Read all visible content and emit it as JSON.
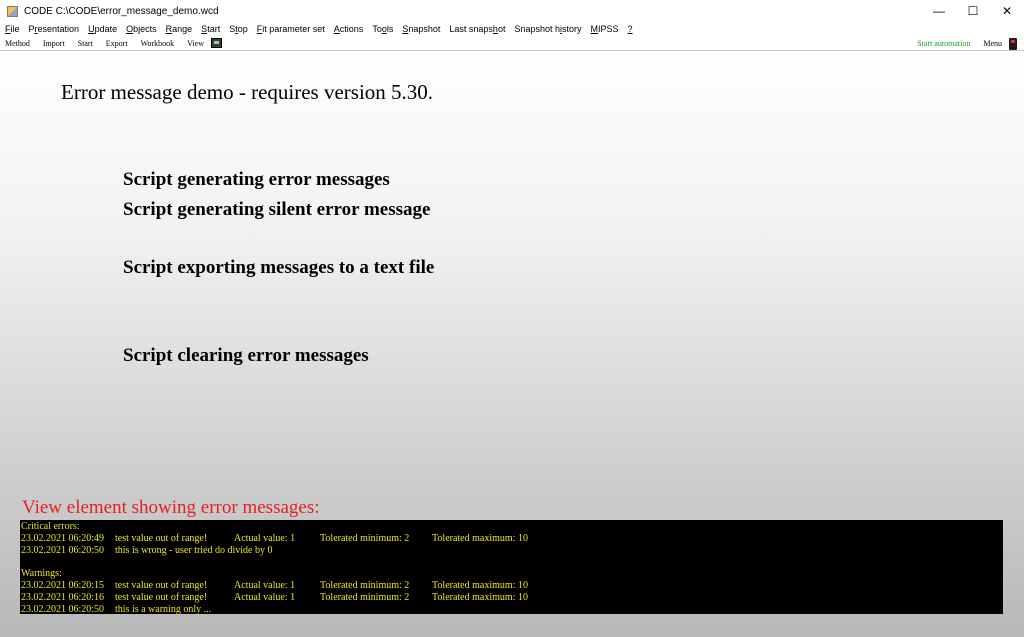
{
  "window": {
    "title": "CODE C:\\CODE\\error_message_demo.wcd",
    "controls": {
      "minimize": "—",
      "maximize": "☐",
      "close": "✕"
    }
  },
  "menu": [
    {
      "pre": "",
      "u": "F",
      "post": "ile",
      "name": "file"
    },
    {
      "pre": "P",
      "u": "r",
      "post": "esentation",
      "name": "presentation"
    },
    {
      "pre": "",
      "u": "U",
      "post": "pdate",
      "name": "update"
    },
    {
      "pre": "",
      "u": "O",
      "post": "bjects",
      "name": "objects"
    },
    {
      "pre": "",
      "u": "R",
      "post": "ange",
      "name": "range"
    },
    {
      "pre": "",
      "u": "S",
      "post": "tart",
      "name": "start"
    },
    {
      "pre": "S",
      "u": "t",
      "post": "op",
      "name": "stop"
    },
    {
      "pre": "",
      "u": "F",
      "post": "it parameter set",
      "name": "fit-parameter-set"
    },
    {
      "pre": "",
      "u": "A",
      "post": "ctions",
      "name": "actions"
    },
    {
      "pre": "To",
      "u": "o",
      "post": "ls",
      "name": "tools"
    },
    {
      "pre": "",
      "u": "S",
      "post": "napshot",
      "name": "snapshot"
    },
    {
      "pre": "Last snaps",
      "u": "h",
      "post": "ot",
      "name": "last-snapshot"
    },
    {
      "pre": "Snapshot h",
      "u": "i",
      "post": "story",
      "name": "snapshot-history"
    },
    {
      "pre": "",
      "u": "M",
      "post": "IPSS",
      "name": "mipss"
    },
    {
      "pre": "",
      "u": "?",
      "post": "",
      "name": "help"
    }
  ],
  "toolbar": {
    "items": [
      "Method",
      "Import",
      "Start",
      "Export",
      "Workbook",
      "View"
    ],
    "start_automation": "Start automation",
    "menu": "Menu"
  },
  "main": {
    "title": "Error message demo - requires version 5.30.",
    "scripts": [
      "Script generating error messages",
      "Script generating silent error message",
      "Script exporting messages to a text file",
      "Script clearing error messages"
    ],
    "view_label": "View element showing error messages:"
  },
  "errors": {
    "critical_heading": "Critical errors:",
    "critical": [
      {
        "time": "23.02.2021 06:20:49",
        "msg": "test value out of range!",
        "actual": "Actual value: 1",
        "min": "Tolerated minimum: 2",
        "max": "Tolerated maximum: 10"
      },
      {
        "time": "23.02.2021 06:20:50",
        "msg": "this is wrong - user tried do divide by 0",
        "actual": "",
        "min": "",
        "max": ""
      }
    ],
    "warnings_heading": "Warnings:",
    "warnings": [
      {
        "time": "23.02.2021 06:20:15",
        "msg": "test value out of range!",
        "actual": "Actual value: 1",
        "min": "Tolerated minimum: 2",
        "max": "Tolerated maximum: 10"
      },
      {
        "time": "23.02.2021 06:20:16",
        "msg": "test value out of range!",
        "actual": "Actual value: 1",
        "min": "Tolerated minimum: 2",
        "max": "Tolerated maximum: 10"
      },
      {
        "time": "23.02.2021 06:20:50",
        "msg": "this is a warning only ...",
        "actual": "",
        "min": "",
        "max": ""
      }
    ]
  },
  "colors": {
    "panel_bg": "#000000",
    "panel_text": "#e8e820",
    "view_label": "#e52020",
    "start_automation": "#1a9a1a"
  }
}
